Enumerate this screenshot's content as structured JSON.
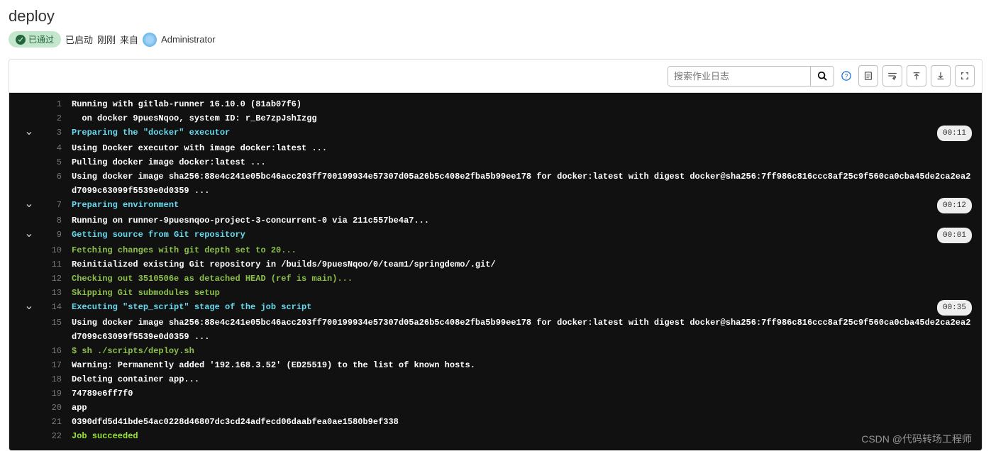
{
  "header": {
    "title": "deploy",
    "badge": "已通过",
    "status": "已启动",
    "time": "刚刚",
    "from": "来自",
    "user": "Administrator"
  },
  "toolbar": {
    "search_placeholder": "搜索作业日志"
  },
  "log": [
    {
      "n": 1,
      "cls": "c-white",
      "text": "Running with gitlab-runner 16.10.0 (81ab07f6)"
    },
    {
      "n": 2,
      "cls": "c-white",
      "text": "  on docker 9puesNqoo, system ID: r_Be7zpJshIzgg"
    },
    {
      "n": 3,
      "cls": "c-cyan",
      "text": "Preparing the \"docker\" executor",
      "section": true,
      "time": "00:11"
    },
    {
      "n": 4,
      "cls": "c-white",
      "text": "Using Docker executor with image docker:latest ..."
    },
    {
      "n": 5,
      "cls": "c-white",
      "text": "Pulling docker image docker:latest ..."
    },
    {
      "n": 6,
      "cls": "c-white",
      "text": "Using docker image sha256:88e4c241e05bc46acc203ff700199934e57307d05a26b5c408e2fba5b99ee178 for docker:latest with digest docker@sha256:7ff986c816ccc8af25c9f560ca0cba45de2ca2ea2d7099c63099f5539e0d0359 ..."
    },
    {
      "n": 7,
      "cls": "c-cyan",
      "text": "Preparing environment",
      "section": true,
      "time": "00:12"
    },
    {
      "n": 8,
      "cls": "c-white",
      "text": "Running on runner-9puesnqoo-project-3-concurrent-0 via 211c557be4a7..."
    },
    {
      "n": 9,
      "cls": "c-cyan",
      "text": "Getting source from Git repository",
      "section": true,
      "time": "00:01"
    },
    {
      "n": 10,
      "cls": "c-green",
      "text": "Fetching changes with git depth set to 20..."
    },
    {
      "n": 11,
      "cls": "c-white",
      "text": "Reinitialized existing Git repository in /builds/9puesNqoo/0/team1/springdemo/.git/"
    },
    {
      "n": 12,
      "cls": "c-green",
      "text": "Checking out 3510506e as detached HEAD (ref is main)..."
    },
    {
      "n": 13,
      "cls": "c-green",
      "text": "Skipping Git submodules setup"
    },
    {
      "n": 14,
      "cls": "c-cyan",
      "text": "Executing \"step_script\" stage of the job script",
      "section": true,
      "time": "00:35"
    },
    {
      "n": 15,
      "cls": "c-white",
      "text": "Using docker image sha256:88e4c241e05bc46acc203ff700199934e57307d05a26b5c408e2fba5b99ee178 for docker:latest with digest docker@sha256:7ff986c816ccc8af25c9f560ca0cba45de2ca2ea2d7099c63099f5539e0d0359 ..."
    },
    {
      "n": 16,
      "cls": "c-green",
      "text": "$ sh ./scripts/deploy.sh"
    },
    {
      "n": 17,
      "cls": "c-white",
      "text": "Warning: Permanently added '192.168.3.52' (ED25519) to the list of known hosts."
    },
    {
      "n": 18,
      "cls": "c-white",
      "text": "Deleting container app..."
    },
    {
      "n": 19,
      "cls": "c-white",
      "text": "74789e6ff7f0"
    },
    {
      "n": 20,
      "cls": "c-white",
      "text": "app"
    },
    {
      "n": 21,
      "cls": "c-white",
      "text": "0390dfd5d41bde54ac0228d46807dc3cd24adfecd06daabfea0ae1580b9ef338"
    },
    {
      "n": 22,
      "cls": "c-lime",
      "text": "Job succeeded"
    }
  ],
  "watermark": "CSDN @代码转场工程师"
}
